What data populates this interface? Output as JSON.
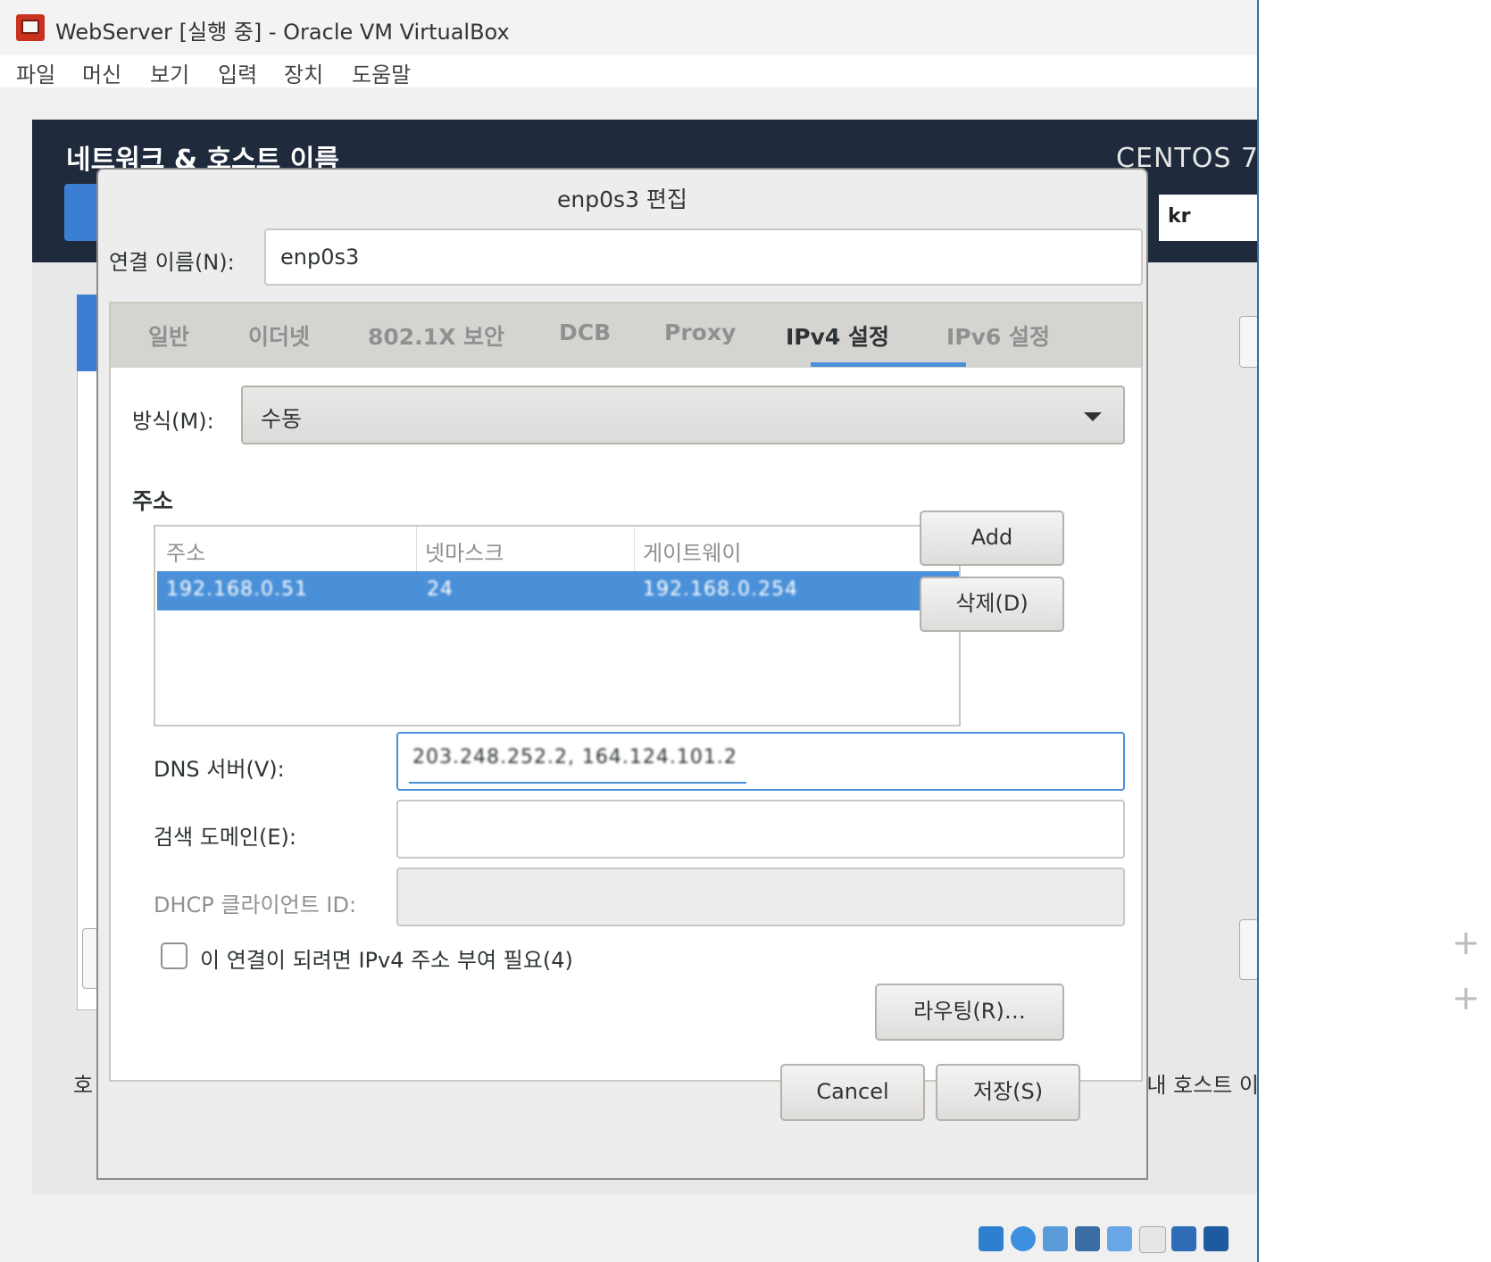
{
  "window": {
    "title": "WebServer [실행 중] - Oracle VM VirtualBox"
  },
  "menu": [
    "파일",
    "머신",
    "보기",
    "입력",
    "장치",
    "도움말"
  ],
  "background": {
    "spoke_title": "네트워크 & 호스트 이름",
    "product": "CENTOS 7",
    "lang_fragment": "kr",
    "left_text_fragment": "호",
    "right_text_fragment": "내 호스트 이"
  },
  "dialog": {
    "title": "enp0s3 편집",
    "connection_name_label": "연결 이름(N):",
    "connection_name_value": "enp0s3",
    "tabs": [
      {
        "label": "일반",
        "active": false
      },
      {
        "label": "이더넷",
        "active": false
      },
      {
        "label": "802.1X 보안",
        "active": false
      },
      {
        "label": "DCB",
        "active": false
      },
      {
        "label": "Proxy",
        "active": false
      },
      {
        "label": "IPv4 설정",
        "active": true
      },
      {
        "label": "IPv6 설정",
        "active": false
      }
    ],
    "method_label": "방식(M):",
    "method_value": "수동",
    "addresses_heading": "주소",
    "address_columns": [
      "주소",
      "넷마스크",
      "게이트웨이"
    ],
    "address_rows": [
      {
        "address": "192.168.0.51",
        "netmask": "24",
        "gateway": "192.168.0.254"
      }
    ],
    "add_button": "Add",
    "delete_button": "삭제(D)",
    "dns_label": "DNS 서버(V):",
    "dns_value": "203.248.252.2, 164.124.101.2",
    "search_domain_label": "검색 도메인(E):",
    "search_domain_value": "",
    "dhcp_client_id_label": "DHCP 클라이언트 ID:",
    "dhcp_client_id_value": "",
    "require_ipv4_label": "이 연결이 되려면 IPv4 주소 부여 필요(4)",
    "require_ipv4_checked": false,
    "routes_button": "라우팅(R)…",
    "cancel_button": "Cancel",
    "save_button": "저장(S)"
  },
  "colors": {
    "accent": "#4a90d9",
    "header_bg": "#1f2a3c",
    "vbox_border": "#3a6ea5"
  }
}
